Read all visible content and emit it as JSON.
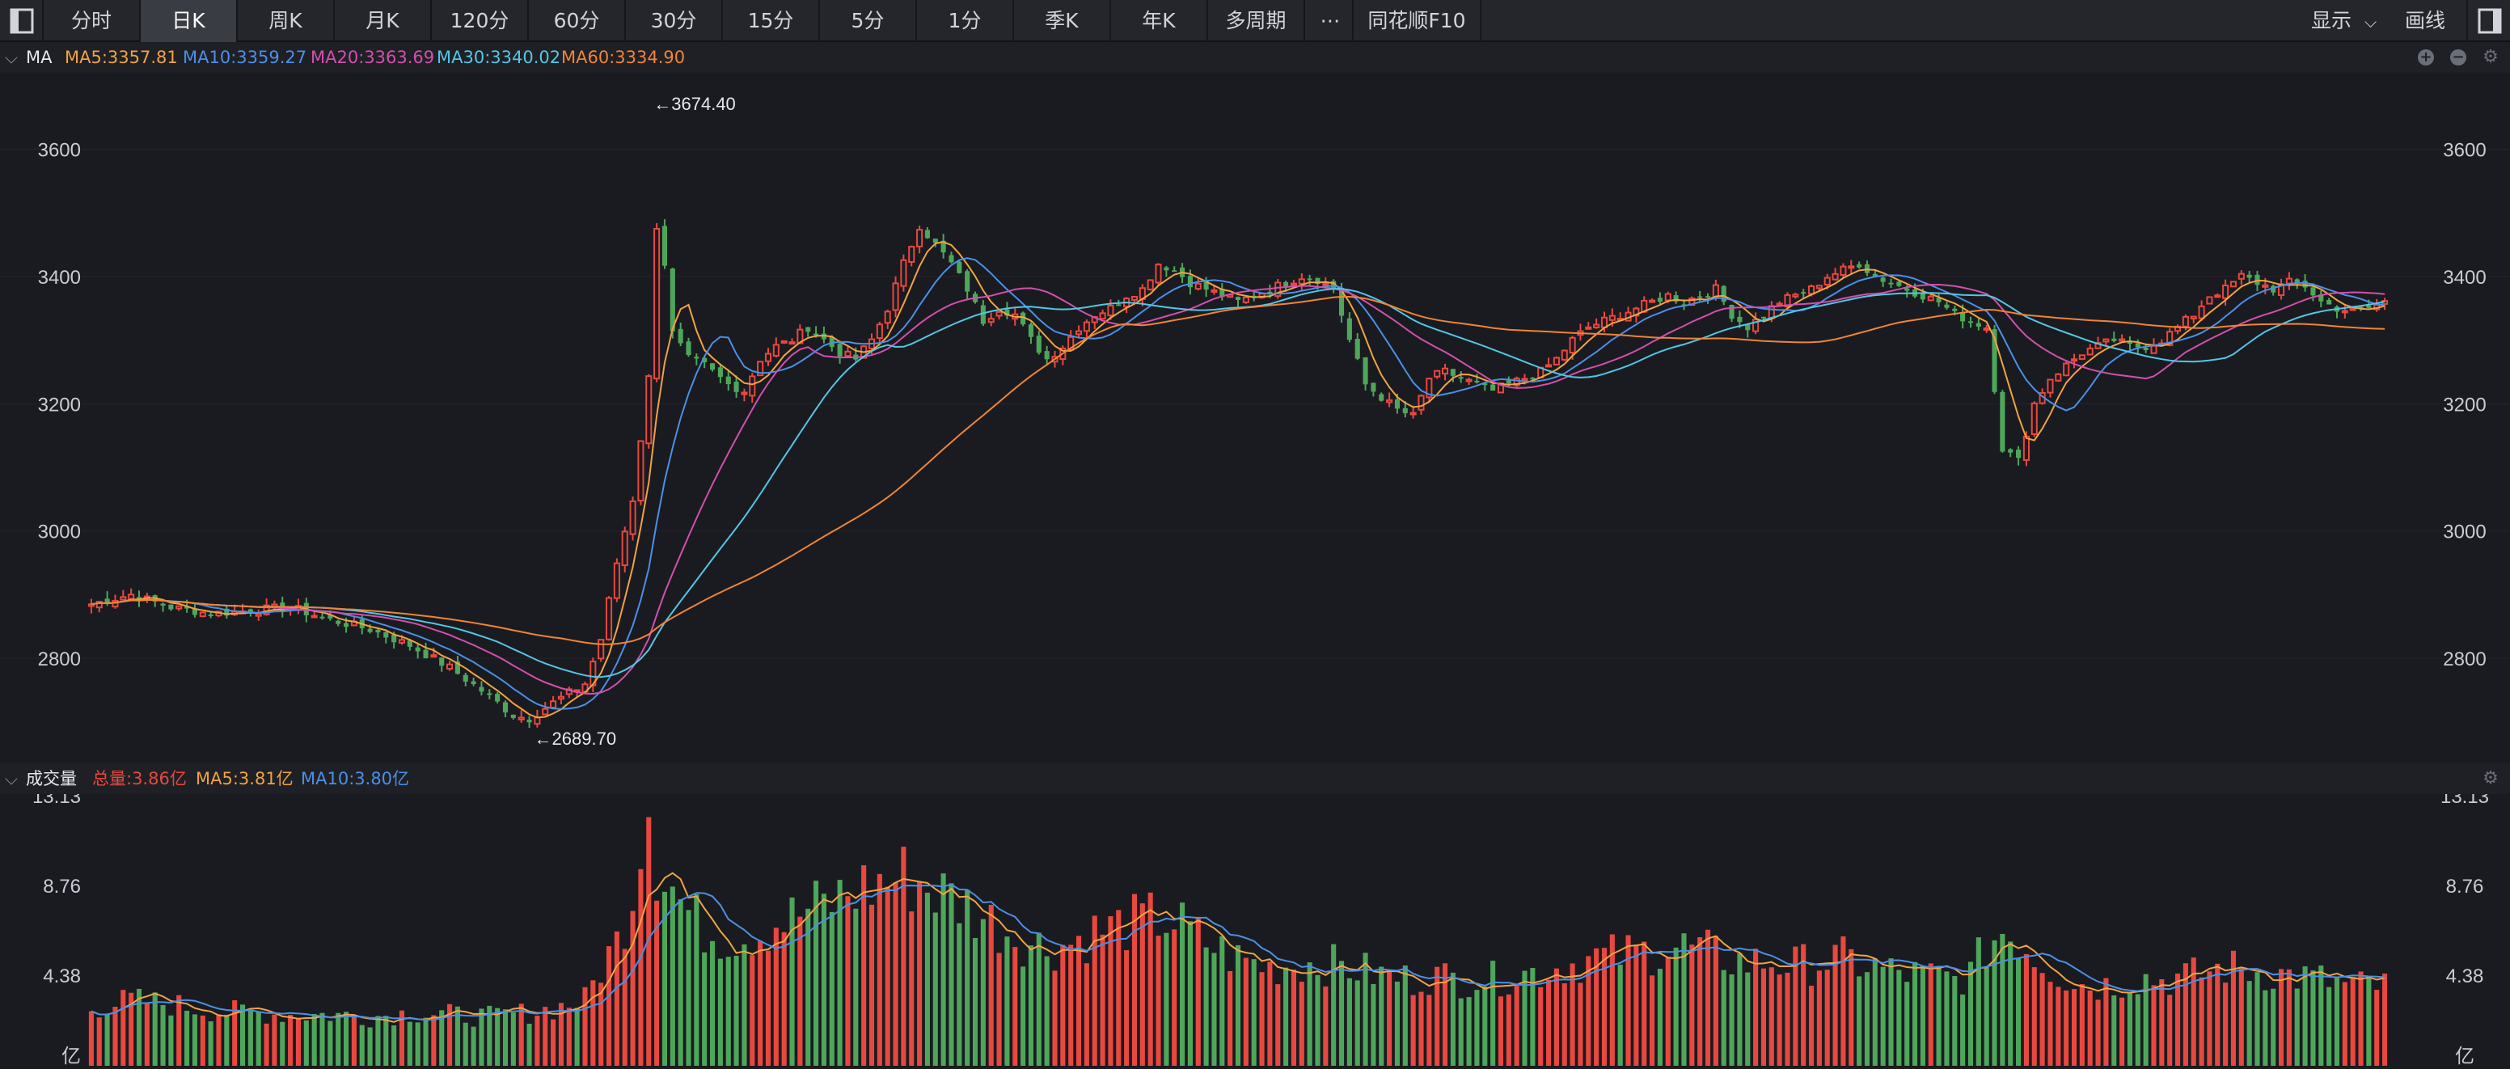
{
  "toolbar": {
    "tabs": [
      "分时",
      "日K",
      "周K",
      "月K",
      "120分",
      "60分",
      "30分",
      "15分",
      "5分",
      "1分",
      "季K",
      "年K",
      "多周期"
    ],
    "active_tab": "日K",
    "more": "⋯",
    "f10": "同花顺F10",
    "display": "显示",
    "draw": "画线"
  },
  "price_header": {
    "label": "MA",
    "ma5": "MA5:3357.81",
    "ma10": "MA10:3359.27",
    "ma20": "MA20:3363.69",
    "ma30": "MA30:3340.02",
    "ma60": "MA60:3334.90"
  },
  "volume_header": {
    "label": "成交量",
    "total": "总量:3.86亿",
    "ma5": "MA5:3.81亿",
    "ma10": "MA10:3.80亿"
  },
  "colors": {
    "up": "#e8483f",
    "down": "#4ea65b",
    "ma5": "#f0a342",
    "ma10": "#4b8fe8",
    "ma20": "#d34fae",
    "ma30": "#53c6e6",
    "ma60": "#f08436",
    "bg": "#1c1d22"
  },
  "chart_data": [
    {
      "type": "candlestick",
      "ylim": [
        2640,
        3720
      ],
      "yticks": [
        2800,
        3000,
        3200,
        3400,
        3600
      ],
      "annotations": [
        {
          "text": "←3674.40",
          "value": 3674.4
        },
        {
          "text": "←2689.70",
          "value": 2689.7
        }
      ],
      "max": 3674.4,
      "min": 2689.7,
      "key_closes": [
        [
          0,
          2885
        ],
        [
          5,
          2900
        ],
        [
          10,
          2880
        ],
        [
          15,
          2870
        ],
        [
          20,
          2875
        ],
        [
          25,
          2880
        ],
        [
          30,
          2860
        ],
        [
          35,
          2845
        ],
        [
          40,
          2820
        ],
        [
          45,
          2785
        ],
        [
          50,
          2740
        ],
        [
          53,
          2710
        ],
        [
          55,
          2705
        ],
        [
          58,
          2730
        ],
        [
          62,
          2760
        ],
        [
          64,
          2830
        ],
        [
          66,
          2950
        ],
        [
          68,
          3050
        ],
        [
          70,
          3240
        ],
        [
          71,
          3480
        ],
        [
          72,
          3420
        ],
        [
          73,
          3310
        ],
        [
          75,
          3270
        ],
        [
          77,
          3260
        ],
        [
          80,
          3230
        ],
        [
          82,
          3220
        ],
        [
          84,
          3270
        ],
        [
          86,
          3290
        ],
        [
          88,
          3300
        ],
        [
          90,
          3320
        ],
        [
          92,
          3300
        ],
        [
          94,
          3280
        ],
        [
          96,
          3270
        ],
        [
          98,
          3300
        ],
        [
          100,
          3350
        ],
        [
          102,
          3420
        ],
        [
          104,
          3480
        ],
        [
          106,
          3450
        ],
        [
          108,
          3420
        ],
        [
          110,
          3380
        ],
        [
          112,
          3330
        ],
        [
          114,
          3350
        ],
        [
          116,
          3340
        ],
        [
          118,
          3300
        ],
        [
          120,
          3270
        ],
        [
          122,
          3290
        ],
        [
          124,
          3320
        ],
        [
          126,
          3340
        ],
        [
          128,
          3350
        ],
        [
          130,
          3370
        ],
        [
          132,
          3380
        ],
        [
          134,
          3420
        ],
        [
          136,
          3410
        ],
        [
          138,
          3390
        ],
        [
          140,
          3380
        ],
        [
          142,
          3370
        ],
        [
          144,
          3360
        ],
        [
          146,
          3370
        ],
        [
          148,
          3380
        ],
        [
          150,
          3390
        ],
        [
          152,
          3400
        ],
        [
          154,
          3395
        ],
        [
          156,
          3380
        ],
        [
          158,
          3300
        ],
        [
          160,
          3230
        ],
        [
          162,
          3210
        ],
        [
          164,
          3190
        ],
        [
          166,
          3180
        ],
        [
          168,
          3240
        ],
        [
          170,
          3250
        ],
        [
          172,
          3240
        ],
        [
          174,
          3230
        ],
        [
          176,
          3220
        ],
        [
          178,
          3230
        ],
        [
          180,
          3240
        ],
        [
          182,
          3250
        ],
        [
          184,
          3270
        ],
        [
          186,
          3300
        ],
        [
          188,
          3320
        ],
        [
          190,
          3330
        ],
        [
          192,
          3340
        ],
        [
          194,
          3350
        ],
        [
          196,
          3360
        ],
        [
          198,
          3370
        ],
        [
          200,
          3360
        ],
        [
          202,
          3370
        ],
        [
          204,
          3380
        ],
        [
          206,
          3340
        ],
        [
          208,
          3320
        ],
        [
          210,
          3340
        ],
        [
          212,
          3360
        ],
        [
          214,
          3370
        ],
        [
          216,
          3380
        ],
        [
          218,
          3400
        ],
        [
          220,
          3410
        ],
        [
          222,
          3420
        ],
        [
          224,
          3400
        ],
        [
          226,
          3390
        ],
        [
          228,
          3380
        ],
        [
          230,
          3370
        ],
        [
          232,
          3360
        ],
        [
          234,
          3340
        ],
        [
          236,
          3330
        ],
        [
          238,
          3320
        ],
        [
          240,
          3130
        ],
        [
          242,
          3110
        ],
        [
          244,
          3200
        ],
        [
          246,
          3240
        ],
        [
          248,
          3260
        ],
        [
          250,
          3280
        ],
        [
          252,
          3290
        ],
        [
          254,
          3300
        ],
        [
          256,
          3290
        ],
        [
          258,
          3290
        ],
        [
          260,
          3300
        ],
        [
          262,
          3320
        ],
        [
          264,
          3340
        ],
        [
          266,
          3370
        ],
        [
          268,
          3380
        ],
        [
          270,
          3400
        ],
        [
          272,
          3390
        ],
        [
          274,
          3380
        ],
        [
          276,
          3390
        ],
        [
          278,
          3385
        ],
        [
          280,
          3360
        ],
        [
          282,
          3350
        ],
        [
          284,
          3345
        ],
        [
          286,
          3350
        ],
        [
          288,
          3360
        ]
      ],
      "series": [
        {
          "name": "MA5",
          "last": 3357.81
        },
        {
          "name": "MA10",
          "last": 3359.27
        },
        {
          "name": "MA20",
          "last": 3363.69
        },
        {
          "name": "MA30",
          "last": 3340.02
        },
        {
          "name": "MA60",
          "last": 3334.9
        }
      ]
    },
    {
      "type": "bar",
      "ylim": [
        0,
        13.13
      ],
      "yticks": [
        "13.13",
        "8.76",
        "4.38",
        "亿"
      ],
      "unit": "亿",
      "key_volumes": [
        [
          0,
          2.8
        ],
        [
          5,
          3.2
        ],
        [
          10,
          3.0
        ],
        [
          15,
          2.7
        ],
        [
          20,
          2.6
        ],
        [
          25,
          2.5
        ],
        [
          30,
          2.5
        ],
        [
          35,
          2.4
        ],
        [
          40,
          2.6
        ],
        [
          45,
          2.5
        ],
        [
          50,
          2.4
        ],
        [
          55,
          2.6
        ],
        [
          58,
          2.8
        ],
        [
          62,
          3.2
        ],
        [
          64,
          4.8
        ],
        [
          66,
          6.0
        ],
        [
          68,
          8.5
        ],
        [
          69,
          11.5
        ],
        [
          70,
          13.13
        ],
        [
          71,
          10.0
        ],
        [
          72,
          9.5
        ],
        [
          74,
          8.0
        ],
        [
          76,
          7.0
        ],
        [
          78,
          6.5
        ],
        [
          80,
          6.3
        ],
        [
          82,
          6.4
        ],
        [
          84,
          6.6
        ],
        [
          86,
          7.0
        ],
        [
          88,
          7.2
        ],
        [
          90,
          7.6
        ],
        [
          92,
          7.8
        ],
        [
          94,
          8.2
        ],
        [
          96,
          8.6
        ],
        [
          98,
          8.8
        ],
        [
          100,
          9.0
        ],
        [
          102,
          9.2
        ],
        [
          104,
          9.0
        ],
        [
          106,
          8.5
        ],
        [
          108,
          8.2
        ],
        [
          110,
          7.8
        ],
        [
          112,
          7.3
        ],
        [
          114,
          6.8
        ],
        [
          116,
          6.4
        ],
        [
          118,
          6.0
        ],
        [
          120,
          5.8
        ],
        [
          122,
          5.9
        ],
        [
          124,
          6.2
        ],
        [
          126,
          6.5
        ],
        [
          128,
          6.7
        ],
        [
          130,
          6.9
        ],
        [
          132,
          7.0
        ],
        [
          134,
          7.2
        ],
        [
          136,
          7.0
        ],
        [
          138,
          6.5
        ],
        [
          140,
          6.0
        ],
        [
          142,
          5.6
        ],
        [
          144,
          5.2
        ],
        [
          146,
          5.0
        ],
        [
          148,
          4.8
        ],
        [
          150,
          4.9
        ],
        [
          152,
          5.0
        ],
        [
          154,
          5.0
        ],
        [
          156,
          4.9
        ],
        [
          158,
          4.8
        ],
        [
          160,
          4.6
        ],
        [
          162,
          4.4
        ],
        [
          164,
          4.3
        ],
        [
          166,
          4.2
        ],
        [
          168,
          4.4
        ],
        [
          170,
          4.3
        ],
        [
          172,
          4.2
        ],
        [
          174,
          4.3
        ],
        [
          176,
          4.2
        ],
        [
          178,
          4.4
        ],
        [
          180,
          4.5
        ],
        [
          182,
          4.6
        ],
        [
          184,
          4.8
        ],
        [
          186,
          5.0
        ],
        [
          188,
          5.2
        ],
        [
          190,
          5.3
        ],
        [
          192,
          5.4
        ],
        [
          194,
          5.5
        ],
        [
          196,
          5.6
        ],
        [
          198,
          5.7
        ],
        [
          200,
          5.8
        ],
        [
          202,
          5.6
        ],
        [
          204,
          5.4
        ],
        [
          206,
          5.2
        ],
        [
          208,
          5.0
        ],
        [
          210,
          5.1
        ],
        [
          212,
          5.0
        ],
        [
          214,
          4.9
        ],
        [
          216,
          5.0
        ],
        [
          218,
          5.1
        ],
        [
          220,
          5.2
        ],
        [
          222,
          5.0
        ],
        [
          224,
          4.8
        ],
        [
          226,
          4.6
        ],
        [
          228,
          4.5
        ],
        [
          230,
          4.4
        ],
        [
          232,
          4.3
        ],
        [
          234,
          4.2
        ],
        [
          236,
          4.5
        ],
        [
          238,
          5.8
        ],
        [
          240,
          6.6
        ],
        [
          242,
          6.2
        ],
        [
          244,
          5.4
        ],
        [
          246,
          4.8
        ],
        [
          248,
          4.3
        ],
        [
          250,
          4.0
        ],
        [
          252,
          3.9
        ],
        [
          254,
          4.0
        ],
        [
          256,
          4.2
        ],
        [
          258,
          4.3
        ],
        [
          260,
          4.2
        ],
        [
          262,
          4.3
        ],
        [
          264,
          4.4
        ],
        [
          266,
          4.6
        ],
        [
          268,
          4.8
        ],
        [
          270,
          4.7
        ],
        [
          272,
          4.6
        ],
        [
          274,
          4.5
        ],
        [
          276,
          4.4
        ],
        [
          278,
          4.3
        ],
        [
          280,
          4.2
        ],
        [
          282,
          4.0
        ],
        [
          284,
          3.9
        ],
        [
          286,
          3.9
        ],
        [
          288,
          3.86
        ]
      ],
      "series": [
        {
          "name": "总量",
          "last": 3.86
        },
        {
          "name": "MA5",
          "last": 3.81
        },
        {
          "name": "MA10",
          "last": 3.8
        }
      ]
    }
  ]
}
